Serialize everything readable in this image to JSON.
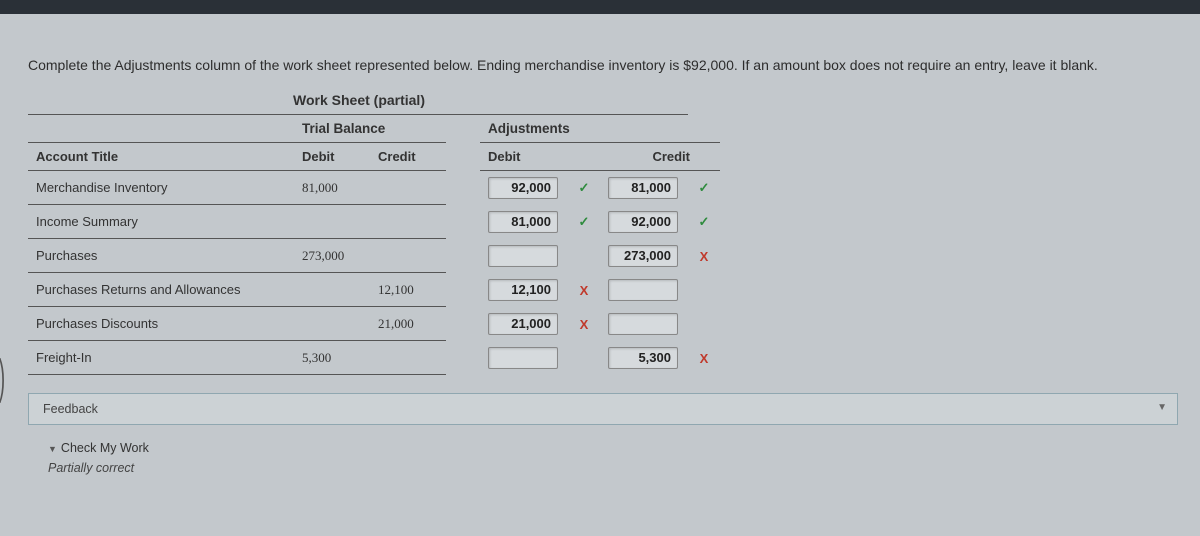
{
  "instructions": "Complete the Adjustments column of the work sheet represented below. Ending merchandise inventory is $92,000. If an amount box does not require an entry, leave it blank.",
  "worksheet_title": "Work Sheet (partial)",
  "group_headers": {
    "trial_balance": "Trial Balance",
    "adjustments": "Adjustments"
  },
  "sub_headers": {
    "account_title": "Account Title",
    "debit": "Debit",
    "credit": "Credit",
    "adj_debit": "Debit",
    "adj_credit": "Credit"
  },
  "rows": [
    {
      "title": "Merchandise Inventory",
      "tb_debit": "81,000",
      "tb_credit": "",
      "adj_debit": "92,000",
      "adj_debit_mark": "check",
      "adj_credit": "81,000",
      "adj_credit_mark": "check"
    },
    {
      "title": "Income Summary",
      "tb_debit": "",
      "tb_credit": "",
      "adj_debit": "81,000",
      "adj_debit_mark": "check",
      "adj_credit": "92,000",
      "adj_credit_mark": "check"
    },
    {
      "title": "Purchases",
      "tb_debit": "273,000",
      "tb_credit": "",
      "adj_debit": "",
      "adj_debit_mark": "",
      "adj_credit": "273,000",
      "adj_credit_mark": "cross"
    },
    {
      "title": "Purchases Returns and Allowances",
      "tb_debit": "",
      "tb_credit": "12,100",
      "adj_debit": "12,100",
      "adj_debit_mark": "cross",
      "adj_credit": "",
      "adj_credit_mark": ""
    },
    {
      "title": "Purchases Discounts",
      "tb_debit": "",
      "tb_credit": "21,000",
      "adj_debit": "21,000",
      "adj_debit_mark": "cross",
      "adj_credit": "",
      "adj_credit_mark": ""
    },
    {
      "title": "Freight-In",
      "tb_debit": "5,300",
      "tb_credit": "",
      "adj_debit": "",
      "adj_debit_mark": "",
      "adj_credit": "5,300",
      "adj_credit_mark": "cross"
    }
  ],
  "feedback": {
    "label": "Feedback"
  },
  "check_my_work": {
    "label": "Check My Work",
    "status": "Partially correct"
  },
  "marks": {
    "check": "✓",
    "cross": "X"
  }
}
